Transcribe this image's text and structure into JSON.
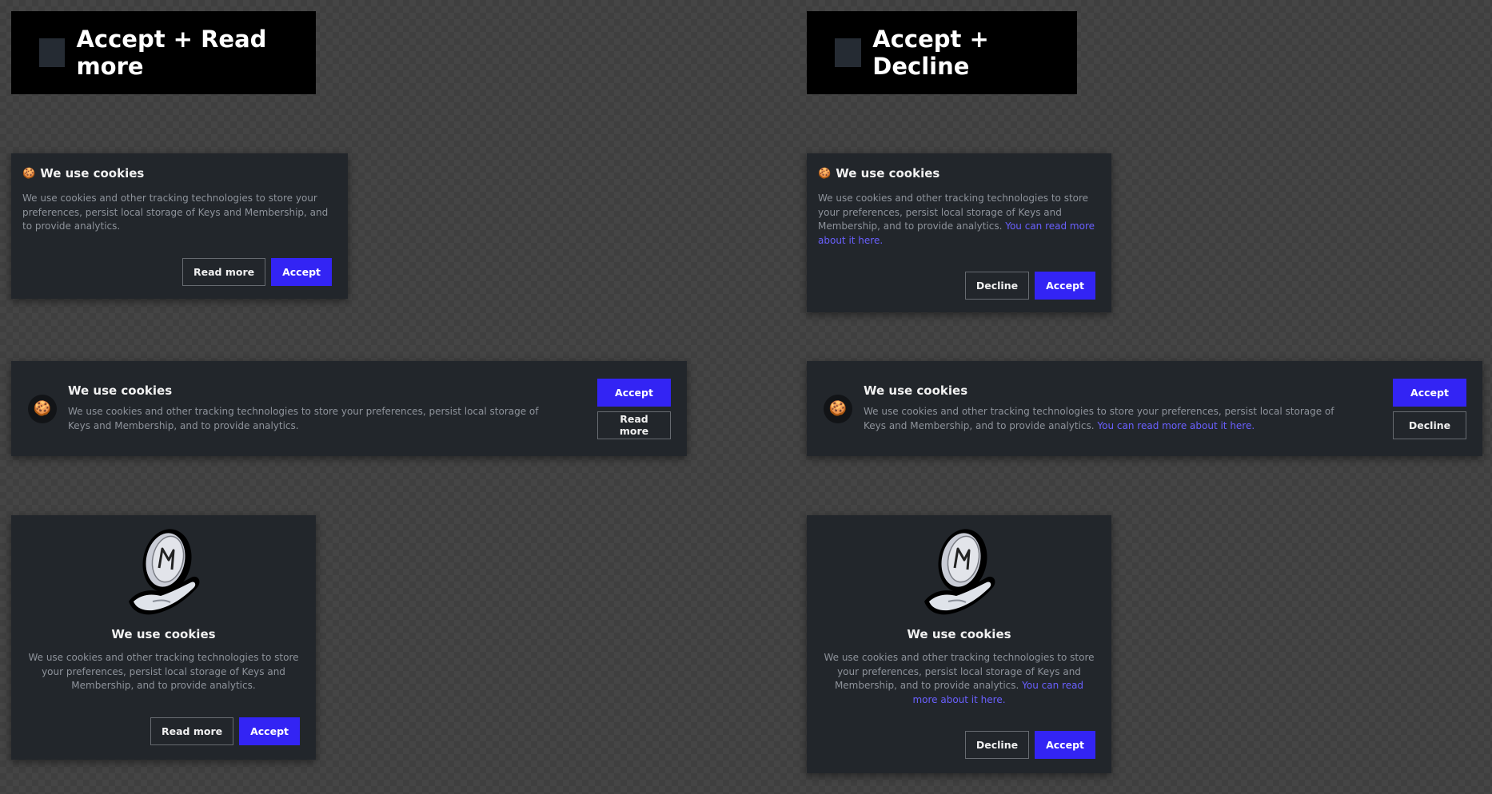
{
  "left": {
    "header": "Accept + Read more",
    "small": {
      "icon": "🍪",
      "title": "We use cookies",
      "body": "We use cookies and other tracking technologies to store your preferences, persist local storage of Keys and Membership, and to provide analytics.",
      "secondary": "Read more",
      "primary": "Accept"
    },
    "wide": {
      "icon": "🍪",
      "title": "We use cookies",
      "body": "We use cookies and other tracking technologies to store your preferences, persist local storage of Keys and Membership, and to provide analytics.",
      "primary": "Accept",
      "secondary": "Read more"
    },
    "center": {
      "title": "We use cookies",
      "body": "We use cookies and other tracking technologies to store your preferences, persist local storage of Keys and Membership, and to provide analytics.",
      "secondary": "Read more",
      "primary": "Accept"
    }
  },
  "right": {
    "header": "Accept + Decline",
    "small": {
      "icon": "🍪",
      "title": "We use cookies",
      "body": "We use cookies and other tracking technologies to store your preferences, persist local storage of Keys and Membership, and to provide analytics.",
      "link": "You can read more about it here.",
      "secondary": "Decline",
      "primary": "Accept"
    },
    "wide": {
      "icon": "🍪",
      "title": "We use cookies",
      "body": "We use cookies and other tracking technologies to store your preferences, persist local storage of Keys and Membership, and to provide analytics.",
      "link": "You can read more about it here.",
      "primary": "Accept",
      "secondary": "Decline"
    },
    "center": {
      "title": "We use cookies",
      "body": "We use cookies and other tracking technologies to store your preferences, persist local storage of Keys and Membership, and to provide analytics.",
      "link": "You can read more about it here.",
      "secondary": "Decline",
      "primary": "Accept"
    }
  },
  "colors": {
    "accent": "#3324f4",
    "link": "#6a60ff",
    "card": "#22262b",
    "header": "#000000"
  },
  "icons": {
    "cookie": "cookie-icon",
    "illustration": "hand-holding-coin-illustration"
  }
}
